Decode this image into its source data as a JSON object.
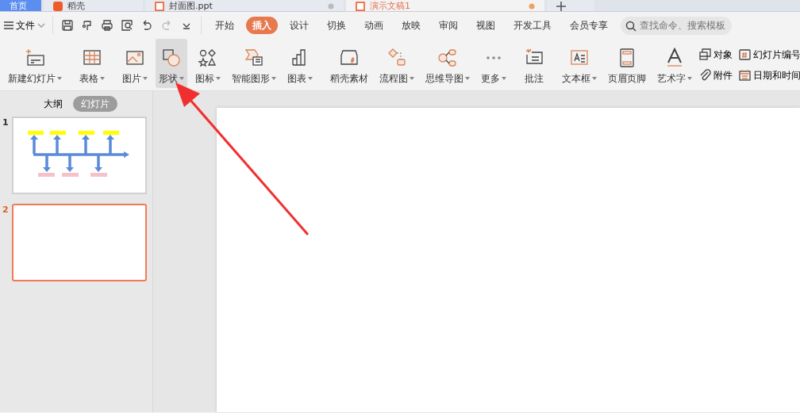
{
  "doc_tabs": [
    {
      "label": "首页",
      "selected": false,
      "kind": "home"
    },
    {
      "label": "稻壳",
      "selected": false,
      "kind": "docer"
    },
    {
      "label": "封面图.ppt",
      "selected": false,
      "kind": "file"
    },
    {
      "label": "演示文稿1",
      "selected": true,
      "kind": "file"
    }
  ],
  "menu": {
    "label": "文件"
  },
  "ribbon_tabs": [
    {
      "label": "开始",
      "selected": false
    },
    {
      "label": "插入",
      "selected": true
    },
    {
      "label": "设计",
      "selected": false
    },
    {
      "label": "切换",
      "selected": false
    },
    {
      "label": "动画",
      "selected": false
    },
    {
      "label": "放映",
      "selected": false
    },
    {
      "label": "审阅",
      "selected": false
    },
    {
      "label": "视图",
      "selected": false
    },
    {
      "label": "开发工具",
      "selected": false
    },
    {
      "label": "会员专享",
      "selected": false
    }
  ],
  "search": {
    "placeholder": "查找命令、搜索模板"
  },
  "ribbon_groups": [
    [
      {
        "label": "新建幻灯片",
        "dropdown": true,
        "selected": false
      }
    ],
    [
      {
        "label": "表格",
        "dropdown": true,
        "selected": false
      }
    ],
    [
      {
        "label": "图片",
        "dropdown": true,
        "selected": false
      },
      {
        "label": "形状",
        "dropdown": true,
        "selected": true
      },
      {
        "label": "图标",
        "dropdown": true,
        "selected": false
      },
      {
        "label": "智能图形",
        "dropdown": true,
        "selected": false
      },
      {
        "label": "图表",
        "dropdown": true,
        "selected": false
      }
    ],
    [
      {
        "label": "稻壳素材",
        "dropdown": false,
        "selected": false
      },
      {
        "label": "流程图",
        "dropdown": true,
        "selected": false
      },
      {
        "label": "思维导图",
        "dropdown": true,
        "selected": false
      },
      {
        "label": "更多",
        "dropdown": true,
        "selected": false
      }
    ],
    [
      {
        "label": "批注",
        "dropdown": false,
        "selected": false
      }
    ],
    [
      {
        "label": "文本框",
        "dropdown": true,
        "selected": false
      },
      {
        "label": "页眉页脚",
        "dropdown": false,
        "selected": false
      },
      {
        "label": "艺术字",
        "dropdown": true,
        "selected": false
      }
    ]
  ],
  "small_tools": [
    {
      "label": "对象"
    },
    {
      "label": "附件"
    },
    {
      "label": "幻灯片编号"
    },
    {
      "label": "日期和时间"
    }
  ],
  "panel_tabs": [
    {
      "label": "大纲",
      "selected": false
    },
    {
      "label": "幻灯片",
      "selected": true
    }
  ],
  "slides": [
    {
      "number": "1",
      "selected": false,
      "kind": "diagram"
    },
    {
      "number": "2",
      "selected": true,
      "kind": "blank"
    }
  ]
}
